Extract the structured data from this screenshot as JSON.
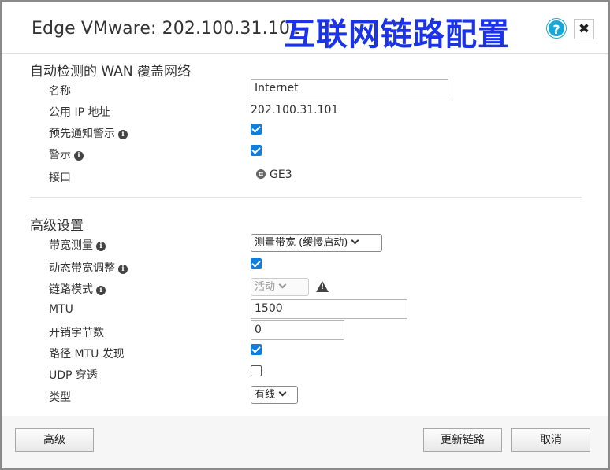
{
  "header": {
    "title": "Edge VMware: 202.100.31.101",
    "banner": "互联网链路配置",
    "help_label": "?",
    "close_label": "✖"
  },
  "auto_wan": {
    "section_title": "自动检测的 WAN 覆盖网络",
    "name_label": "名称",
    "name_value": "Internet",
    "public_ip_label": "公用 IP 地址",
    "public_ip_value": "202.100.31.101",
    "pre_notify_label": "预先通知警示",
    "pre_notify_checked": true,
    "alert_label": "警示",
    "alert_checked": true,
    "interface_label": "接口",
    "interface_value": "GE3",
    "interface_icon": "interface-icon"
  },
  "advanced": {
    "section_title": "高级设置",
    "bandwidth_label": "带宽测量",
    "bandwidth_value": "测量带宽 (缓慢启动)",
    "dynamic_bw_label": "动态带宽调整",
    "dynamic_bw_checked": true,
    "link_mode_label": "链路模式",
    "link_mode_value": "活动",
    "link_mode_disabled": true,
    "mtu_label": "MTU",
    "mtu_value": "1500",
    "overhead_label": "开销字节数",
    "overhead_value": "0",
    "path_mtu_label": "路径 MTU 发现",
    "path_mtu_checked": true,
    "udp_label": "UDP 穿透",
    "udp_checked": false,
    "type_label": "类型",
    "type_value": "有线"
  },
  "footer": {
    "advanced_button": "高级",
    "update_button": "更新链路",
    "cancel_button": "取消"
  },
  "colors": {
    "banner": "#1a33e6",
    "checkbox": "#0f7fdb",
    "help": "#16a8d8"
  }
}
